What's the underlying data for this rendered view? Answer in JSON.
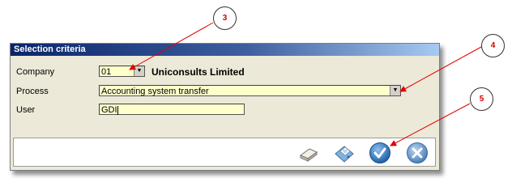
{
  "dialog": {
    "title": "Selection criteria",
    "company": {
      "label": "Company",
      "value": "01",
      "name": "Uniconsults Limited"
    },
    "process": {
      "label": "Process",
      "value": "Accounting system transfer"
    },
    "user": {
      "label": "User",
      "value": "GDI"
    }
  },
  "callouts": {
    "c3": "3",
    "c4": "4",
    "c5": "5"
  },
  "colors": {
    "field_bg": "#ffffcc",
    "dialog_bg": "#ece9d8",
    "callout_text": "#d00000",
    "arrow": "#e00000"
  }
}
